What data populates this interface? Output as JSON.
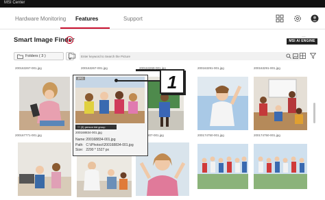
{
  "window": {
    "title": "MSI Center"
  },
  "nav": {
    "tabs": [
      {
        "label": "Hardware Monitoring",
        "active": false
      },
      {
        "label": "Features",
        "active": true
      },
      {
        "label": "Support",
        "active": false
      }
    ],
    "accent_color": "#c8102e"
  },
  "header": {
    "title": "Smart Image Finder",
    "engine_badge": "MSI AI ENGINE"
  },
  "toolbar": {
    "folder_label": "Folders ( 3 )",
    "search_placeholder": "Enter keyword to Search the Picture"
  },
  "photos": [
    {
      "caption": "200163267-001.jpg"
    },
    {
      "caption": "200163267-001.jpg"
    },
    {
      "caption": "200163269-001.jpg"
    },
    {
      "caption": "200163291-001.jpg"
    },
    {
      "caption": "200163291-001.jpg"
    },
    {
      "caption": "200167771-001.jpg"
    },
    {
      "caption": "200168834-001.jpg"
    },
    {
      "caption": "200169807-001.jpg"
    },
    {
      "caption": "200174750-001.jpg"
    },
    {
      "caption": "200174750-001.jpg"
    }
  ],
  "selected": {
    "format": "JPG",
    "tags": "(3) person  kid  group",
    "caption": "200168834-001.jpg",
    "name_label": "Name:",
    "name": "200168834-001.jpg",
    "path_label": "Path:",
    "path": "C:\\\\Photos\\\\200168834-001.jpg",
    "size_label": "Size:",
    "size": "2290 * 1527 px"
  },
  "callout": {
    "number": "1"
  }
}
